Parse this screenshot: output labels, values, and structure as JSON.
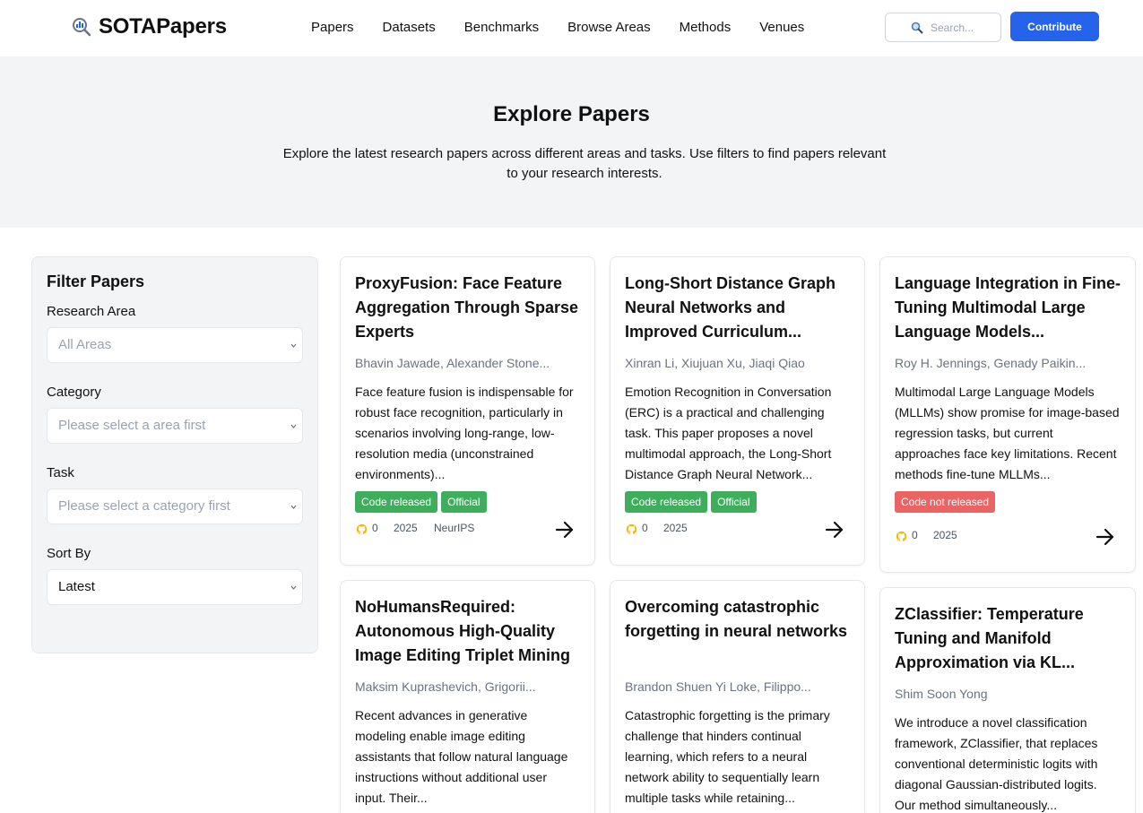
{
  "header": {
    "logo_text": "SOTAPapers",
    "nav": [
      "Papers",
      "Datasets",
      "Benchmarks",
      "Browse Areas",
      "Methods",
      "Venues"
    ],
    "search_placeholder": "Search...",
    "contribute_label": "Contribute"
  },
  "hero": {
    "title": "Explore Papers",
    "description": "Explore the latest research papers across different areas and tasks. Use filters to find papers relevant to your research interests."
  },
  "filters": {
    "title": "Filter Papers",
    "research_area": {
      "label": "Research Area",
      "value": "All Areas"
    },
    "category": {
      "label": "Category",
      "value": "Please select a area first"
    },
    "task": {
      "label": "Task",
      "value": "Please select a category first"
    },
    "sort_by": {
      "label": "Sort By",
      "value": "Latest"
    }
  },
  "colors": {
    "accent": "#2563eb",
    "badge_green": "#3fae5c",
    "badge_red": "#ea6464",
    "star_icon": "#f5b700"
  },
  "papers": [
    {
      "title": "ProxyFusion: Face Feature Aggregation Through Sparse Experts",
      "authors": "Bhavin Jawade, Alexander Stone...",
      "abstract": "Face feature fusion is indispensable for robust face recognition, particularly in scenarios involving long-range, low-resolution media (unconstrained environments)...",
      "badges": [
        "Code released",
        "Official"
      ],
      "stars": "0",
      "year": "2025",
      "venue": "NeurIPS"
    },
    {
      "title": "Long-Short Distance Graph Neural Networks and Improved Curriculum...",
      "authors": "Xinran Li, Xiujuan Xu, Jiaqi Qiao",
      "abstract": "Emotion Recognition in Conversation (ERC) is a practical and challenging task. This paper proposes a novel multimodal approach, the Long-Short Distance Graph Neural Network...",
      "badges": [
        "Code released",
        "Official"
      ],
      "stars": "0",
      "year": "2025",
      "venue": ""
    },
    {
      "title": "Language Integration in Fine-Tuning Multimodal Large Language Models...",
      "authors": "Roy H. Jennings, Genady Paikin...",
      "abstract": "Multimodal Large Language Models (MLLMs) show promise for image-based regression tasks, but current approaches face key limitations. Recent methods fine-tune MLLMs...",
      "badges": [
        "Code not released"
      ],
      "stars": "0",
      "year": "2025",
      "venue": ""
    },
    {
      "title": "NoHumansRequired: Autonomous High-Quality Image Editing Triplet Mining",
      "authors": "Maksim Kuprashevich, Grigorii...",
      "abstract": "Recent advances in generative modeling enable image editing assistants that follow natural language instructions without additional user input. Their..."
    },
    {
      "title": "Overcoming catastrophic forgetting in neural networks",
      "authors": "Brandon Shuen Yi Loke, Filippo...",
      "abstract": "Catastrophic forgetting is the primary challenge that hinders continual learning, which refers to a neural network ability to sequentially learn multiple tasks while retaining..."
    },
    {
      "title": "ZClassifier: Temperature Tuning and Manifold Approximation via KL...",
      "authors": "Shim Soon Yong",
      "abstract": "We introduce a novel classification framework, ZClassifier, that replaces conventional deterministic logits with diagonal Gaussian-distributed logits. Our method simultaneously..."
    }
  ]
}
